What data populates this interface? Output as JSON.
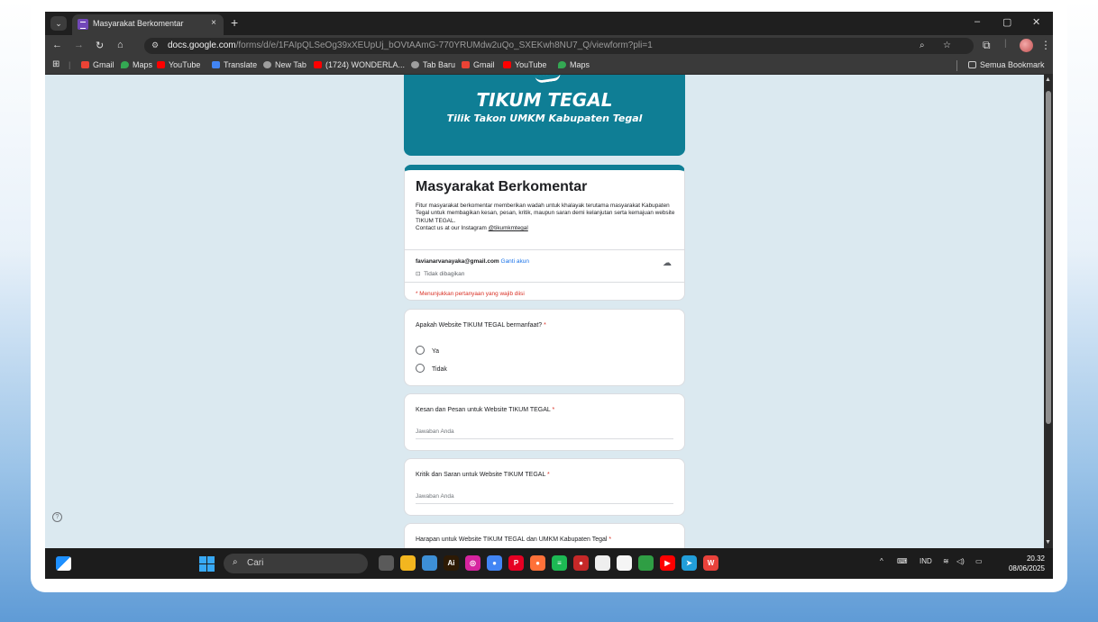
{
  "browser": {
    "tab_title": "Masyarakat Berkomentar",
    "tab_close": "×",
    "new_tab": "+",
    "url_domain": "docs.google.com",
    "url_path": "/forms/d/e/1FAIpQLSeOg39xXEUpUj_bOVtAAmG-770YRUMdw2uQo_SXEKwh8NU7_Q/viewform?pli=1",
    "win_minimize": "–",
    "win_restore": "▢",
    "win_close": "✕"
  },
  "bookmarks": {
    "items": [
      {
        "label": "Gmail",
        "color": "#ea4335"
      },
      {
        "label": "Maps",
        "color": "#34a853"
      },
      {
        "label": "YouTube",
        "color": "#ff0000"
      },
      {
        "label": "Translate",
        "color": "#4285f4"
      },
      {
        "label": "New Tab",
        "color": "#9e9e9e"
      },
      {
        "label": "(1724) WONDERLA...",
        "color": "#ff0000"
      },
      {
        "label": "Tab Baru",
        "color": "#9e9e9e"
      },
      {
        "label": "Gmail",
        "color": "#ea4335"
      },
      {
        "label": "YouTube",
        "color": "#ff0000"
      },
      {
        "label": "Maps",
        "color": "#34a853"
      }
    ],
    "all_bookmarks": "Semua Bookmark"
  },
  "banner": {
    "title": "TIKUM TEGAL",
    "subtitle": "Tilik Takon UMKM Kabupaten Tegal",
    "color": "#0f7e95"
  },
  "form": {
    "title": "Masyarakat Berkomentar",
    "description": "Fitur masyarakat berkomentar memberikan wadah untuk khalayak terutama masyarakat Kabupaten Tegal untuk membagikan kesan, pesan, kritik, maupun saran demi kelanjutan serta kemajuan website TIKUM TEGAL.",
    "contact_prefix": "Contact us at our Instagram ",
    "contact_handle": "@tikumkmtegal",
    "account_email": "favianarvanayaka@gmail.com",
    "switch_account": "Ganti akun",
    "not_shared": "Tidak dibagikan",
    "required_note": "* Menunjukkan pertanyaan yang wajib diisi",
    "questions": [
      {
        "title": "Apakah Website TIKUM TEGAL bermanfaat?",
        "options": [
          "Ya",
          "Tidak"
        ]
      },
      {
        "title": "Kesan dan Pesan untuk Website TIKUM TEGAL",
        "placeholder": "Jawaban Anda"
      },
      {
        "title": "Kritik dan Saran untuk Website TIKUM TEGAL",
        "placeholder": "Jawaban Anda"
      },
      {
        "title": "Harapan untuk Website TIKUM TEGAL dan UMKM Kabupaten Tegal"
      }
    ],
    "required_mark": "*"
  },
  "taskbar": {
    "search_label": "Cari",
    "language": "IND",
    "time": "20.32",
    "date": "08/06/2025",
    "apps": [
      {
        "name": "task-view",
        "color": "#5a5a5a",
        "glyph": ""
      },
      {
        "name": "file-explorer",
        "color": "#f3b61f",
        "glyph": ""
      },
      {
        "name": "copilot",
        "color": "#3d8fd6",
        "glyph": ""
      },
      {
        "name": "adobe-illustrator",
        "color": "#2d1a05",
        "glyph": "Ai"
      },
      {
        "name": "instagram",
        "color": "#d6249f",
        "glyph": "◎"
      },
      {
        "name": "chrome",
        "color": "#4285f4",
        "glyph": "●"
      },
      {
        "name": "pinterest",
        "color": "#e60023",
        "glyph": "P"
      },
      {
        "name": "firefox",
        "color": "#ff7139",
        "glyph": "●"
      },
      {
        "name": "spotify",
        "color": "#1db954",
        "glyph": "≡"
      },
      {
        "name": "maps-app",
        "color": "#c62828",
        "glyph": "●"
      },
      {
        "name": "document",
        "color": "#eeeeee",
        "glyph": ""
      },
      {
        "name": "notes",
        "color": "#f5f5f5",
        "glyph": ""
      },
      {
        "name": "calendar",
        "color": "#2f9e44",
        "glyph": ""
      },
      {
        "name": "youtube-app",
        "color": "#ff0000",
        "glyph": "▶"
      },
      {
        "name": "telegram",
        "color": "#229ed9",
        "glyph": "➤"
      },
      {
        "name": "wps-office",
        "color": "#e8423b",
        "glyph": "W"
      }
    ]
  }
}
